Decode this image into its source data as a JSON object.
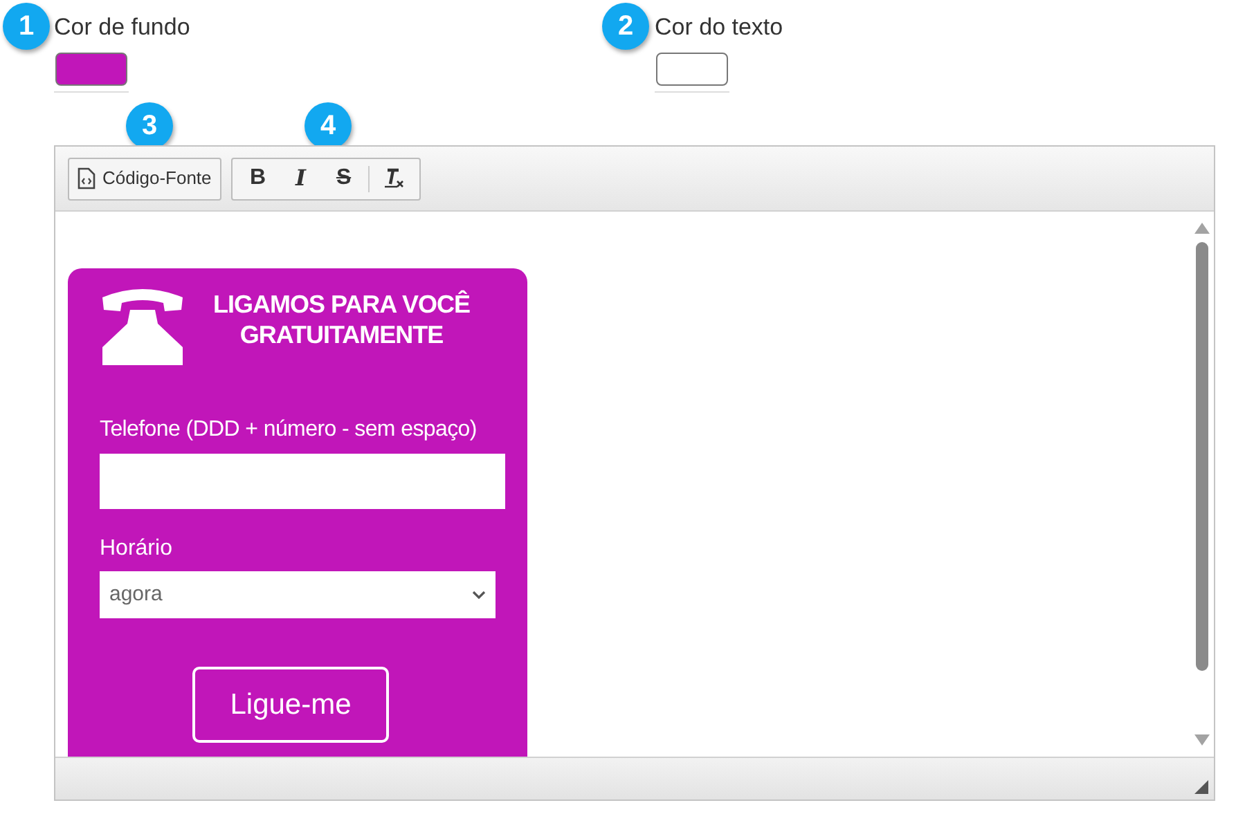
{
  "color_fields": [
    {
      "badge": "1",
      "label": "Cor de fundo",
      "color": "#c116b9"
    },
    {
      "badge": "2",
      "label": "Cor do texto",
      "color": "#ffffff"
    }
  ],
  "toolbar_badges": [
    "3",
    "4"
  ],
  "toolbar": {
    "source_button": "Código-Fonte",
    "format_buttons": [
      {
        "kind": "bold",
        "label": "B"
      },
      {
        "kind": "italic",
        "label": "I"
      },
      {
        "kind": "strike",
        "label": "S"
      }
    ]
  },
  "widget": {
    "title_lines": [
      "LIGAMOS PARA VOCÊ",
      "GRATUITAMENTE"
    ],
    "phone_label": "Telefone (DDD + número - sem espaço)",
    "time_label": "Horário",
    "time_value": "agora",
    "button": "Ligue-me"
  }
}
